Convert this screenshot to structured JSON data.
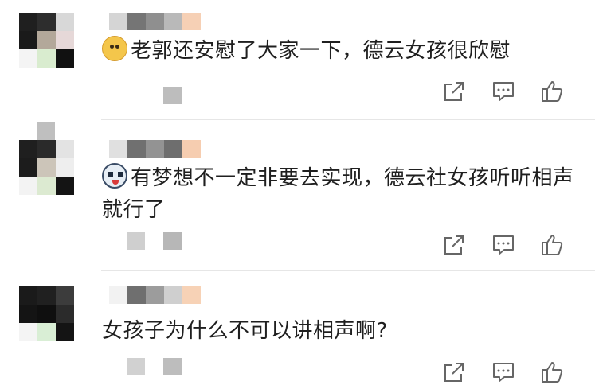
{
  "comments": [
    {
      "text": "老郭还安慰了大家一下，德云女孩很欣慰",
      "emoji_icon": "doge-emoji-icon",
      "avatar_colors": [
        "#1f1f1f",
        "#2d2d2d",
        "#d8d8d8",
        "#1a1a1a",
        "#b3a89a",
        "#e6d8d8",
        "#f4f4f4",
        "#d9eccf",
        "#111111"
      ],
      "name_colors": [
        "#d5d5d5",
        "#757575",
        "#8f8f8f",
        "#b9b9b9",
        "#f6d0b5"
      ],
      "meta_colors": [
        "#bdbdbd"
      ]
    },
    {
      "text": "有梦想不一定非要去实现，德云社女孩听听相声就行了",
      "emoji_icon": "panda-emoji-icon",
      "avatar_colors": [
        "#1f1f1f",
        "#2a2a2a",
        "#e3e3e3",
        "#1c1c1c",
        "#ccc5b9",
        "#eeeeee",
        "#f3f3f3",
        "#dcead1",
        "#141414"
      ],
      "name_colors": [
        "#e0e0e0",
        "#707070",
        "#939393",
        "#6e6e6e",
        "#f6cdb0"
      ],
      "meta_colors": [
        "#cfcfcf",
        "#b7b7b7"
      ]
    },
    {
      "text": "女孩子为什么不可以讲相声啊?",
      "emoji_icon": "",
      "avatar_colors": [
        "#1a1a1a",
        "#202020",
        "#3c3c3c",
        "#141414",
        "#0f0f0f",
        "#2b2b2b",
        "#f4f4f4",
        "#d9eed5",
        "#141414"
      ],
      "name_colors": [
        "#f2f2f2",
        "#6f6f6f",
        "#9c9c9c",
        "#cfcfcf",
        "#f7d2b6"
      ],
      "meta_colors": [
        "#d1d1d1",
        "#bdbdbd"
      ]
    }
  ]
}
